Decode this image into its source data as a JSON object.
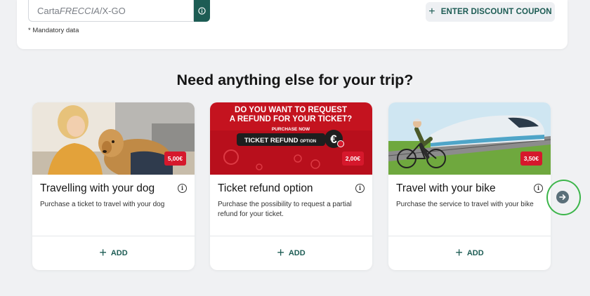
{
  "form": {
    "card_prefix": "Carta",
    "card_name": "FRECCIA",
    "card_suffix": "/X-GO",
    "mandatory_note": "* Mandatory data",
    "coupon_label": "ENTER DISCOUNT COUPON"
  },
  "section_title": "Need anything else for your trip?",
  "products": [
    {
      "title": "Travelling with your dog",
      "description": "Purchase a ticket to travel with your dog",
      "price": "5,00€",
      "add_label": "ADD"
    },
    {
      "title": "Ticket refund option",
      "description": "Purchase the possibility to request a partial refund for your ticket.",
      "price": "2,00€",
      "add_label": "ADD",
      "banner": {
        "line1": "DO YOU WANT TO REQUEST",
        "line2": "A REFUND FOR YOUR TICKET?",
        "line3": "PURCHASE NOW",
        "line4": "TICKET REFUND",
        "line4_small": "OPTION"
      }
    },
    {
      "title": "Travel with your bike",
      "description": "Purchase the service to travel with your bike",
      "price": "3,50€",
      "add_label": "ADD"
    }
  ],
  "colors": {
    "brand_green": "#1d5c54",
    "price_red": "#d6182c",
    "highlight_ring": "#3cb54a",
    "page_bg": "#f0f1f3"
  },
  "icons": [
    "info-icon",
    "plus-icon",
    "arrow-right-icon"
  ]
}
